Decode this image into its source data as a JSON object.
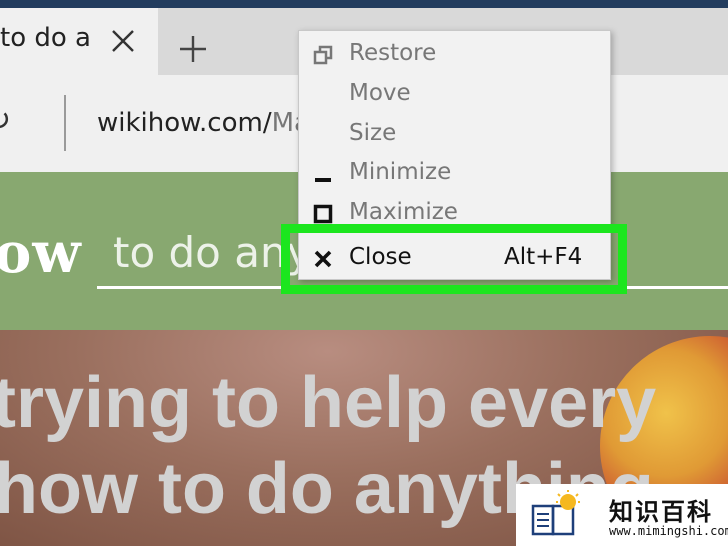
{
  "browser": {
    "tab": {
      "title": "to do ar"
    },
    "address": {
      "url_prefix": "wikihow.com/",
      "url_rest": "Ma"
    }
  },
  "site": {
    "logo": "ow",
    "search_placeholder": "to do any",
    "header_color": "#88a870"
  },
  "hero": {
    "line1": "trying to help every",
    "line2": "how to do anything"
  },
  "context_menu": {
    "items": [
      {
        "label": "Restore",
        "icon": "restore-icon",
        "enabled": false
      },
      {
        "label": "Move",
        "icon": "",
        "enabled": false
      },
      {
        "label": "Size",
        "icon": "",
        "enabled": false
      },
      {
        "label": "Minimize",
        "icon": "minimize-icon",
        "enabled": false
      },
      {
        "label": "Maximize",
        "icon": "maximize-icon",
        "enabled": false
      },
      {
        "label": "Close",
        "icon": "close-icon",
        "enabled": true,
        "shortcut": "Alt+F4"
      }
    ],
    "highlight_color": "#1ce61e"
  },
  "watermark": {
    "title": "知识百科",
    "url": "www.mimingshi.com"
  }
}
